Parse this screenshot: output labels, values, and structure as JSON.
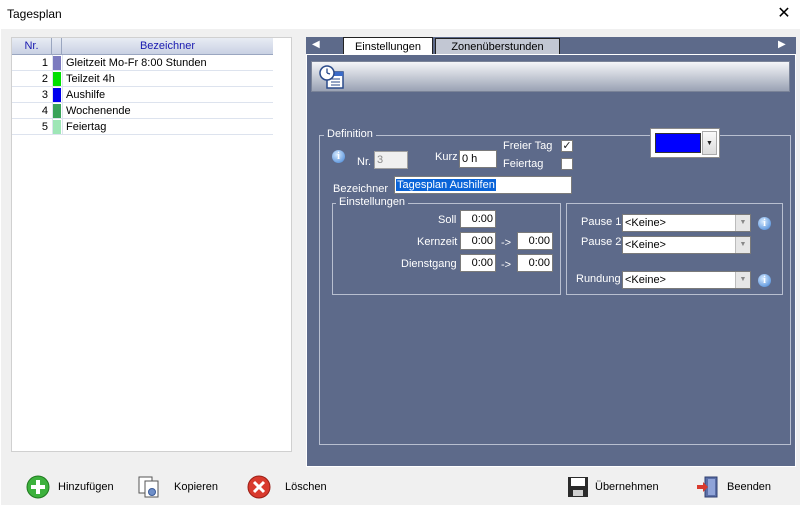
{
  "window": {
    "title": "Tagesplan",
    "close_glyph": "✕"
  },
  "grid": {
    "headers": {
      "nr": "Nr.",
      "name": "Bezeichner"
    },
    "rows": [
      {
        "nr": "1",
        "color": "#7b7bbf",
        "name": "Gleitzeit Mo-Fr 8:00 Stunden"
      },
      {
        "nr": "2",
        "color": "#00e000",
        "name": "Teilzeit 4h"
      },
      {
        "nr": "3",
        "color": "#0000ee",
        "name": "Aushilfe"
      },
      {
        "nr": "4",
        "color": "#3aa35a",
        "name": "Wochenende"
      },
      {
        "nr": "5",
        "color": "#9ee6b6",
        "name": "Feiertag"
      }
    ]
  },
  "tabs": {
    "left_arrow": "◀",
    "right_arrow": "▶",
    "items": [
      "Einstellungen",
      "Zonenüberstunden"
    ],
    "active": "Einstellungen"
  },
  "definition": {
    "legend": "Definition",
    "nr_label": "Nr.",
    "nr_value": "3",
    "kurz_label": "Kurz",
    "kurz_value": "0 h",
    "freier_tag_label": "Freier Tag",
    "freier_tag_checked": "✓",
    "feiertag_label": "Feiertag",
    "feiertag_checked": "",
    "bezeichner_label": "Bezeichner",
    "bezeichner_value": "Tagesplan Aushilfen",
    "color": "#0000ff"
  },
  "settings": {
    "legend": "Einstellungen",
    "soll_label": "Soll",
    "soll_value": "0:00",
    "kernzeit_label": "Kernzeit",
    "kernzeit_from": "0:00",
    "kernzeit_to": "0:00",
    "dienstgang_label": "Dienstgang",
    "dienstgang_from": "0:00",
    "dienstgang_to": "0:00",
    "arrow": "->"
  },
  "pauses": {
    "pause1_label": "Pause 1",
    "pause1_value": "<Keine>",
    "pause2_label": "Pause 2",
    "pause2_value": "<Keine>",
    "rundung_label": "Rundung",
    "rundung_value": "<Keine>"
  },
  "info_glyph": "i",
  "dropdown_glyph": "▼",
  "toolbar": {
    "add": "Hinzufügen",
    "copy": "Kopieren",
    "delete": "Löschen",
    "apply": "Übernehmen",
    "exit": "Beenden"
  }
}
